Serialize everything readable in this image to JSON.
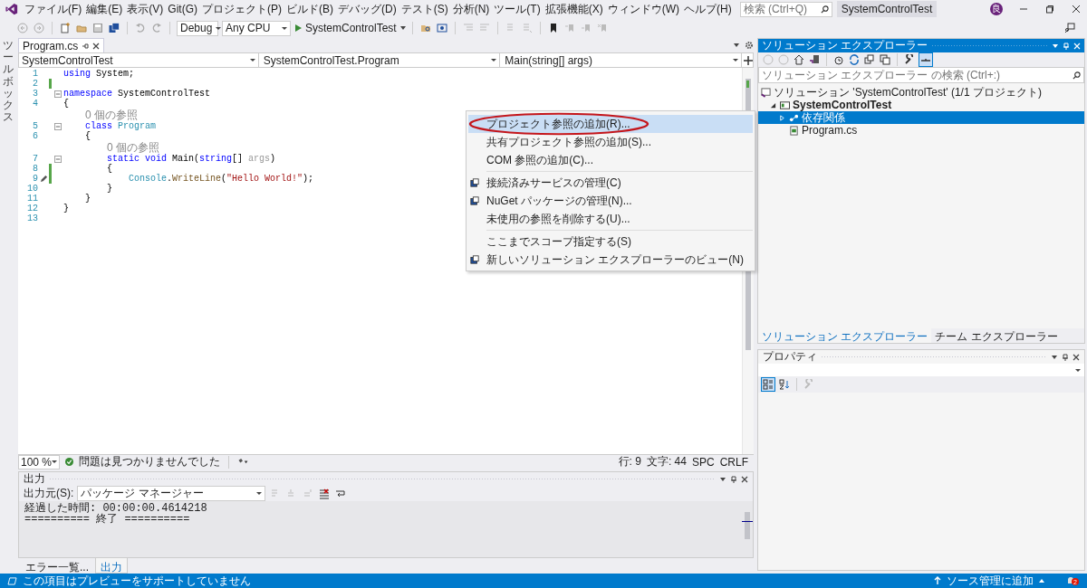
{
  "window": {
    "title": "SystemControlTest",
    "search": {
      "placeholder": "検索 (Ctrl+Q)"
    },
    "account_initial": "良"
  },
  "menu": [
    "ファイル(F)",
    "編集(E)",
    "表示(V)",
    "Git(G)",
    "プロジェクト(P)",
    "ビルド(B)",
    "デバッグ(D)",
    "テスト(S)",
    "分析(N)",
    "ツール(T)",
    "拡張機能(X)",
    "ウィンドウ(W)",
    "ヘルプ(H)"
  ],
  "toolbar": {
    "configuration": "Debug",
    "platform": "Any CPU",
    "start": "SystemControlTest"
  },
  "toolbox_label": "ツールボックス",
  "document_tabs": [
    {
      "label": "Program.cs",
      "selected": true
    }
  ],
  "nav_bar": [
    "SystemControlTest",
    "SystemControlTest.Program",
    "Main(string[] args)"
  ],
  "code_lines": [
    {
      "kind": "code",
      "number": "1",
      "changed": false,
      "fold": false,
      "quick_action": false,
      "segments": [
        {
          "kind": "kw",
          "text": "using"
        },
        {
          "kind": "plain",
          "text": " System;"
        }
      ]
    },
    {
      "kind": "code",
      "number": "2",
      "changed": true,
      "fold": false,
      "quick_action": false
    },
    {
      "kind": "code",
      "number": "3",
      "changed": false,
      "fold": true,
      "quick_action": false,
      "segments": [
        {
          "kind": "kw",
          "text": "namespace"
        },
        {
          "kind": "plain",
          "text": " SystemControlTest"
        }
      ]
    },
    {
      "kind": "code",
      "number": "4",
      "changed": false,
      "fold": false,
      "quick_action": false,
      "segments": [
        {
          "kind": "plain",
          "text": "{"
        }
      ]
    },
    {
      "kind": "codelens",
      "text": "0 個の参照"
    },
    {
      "kind": "code",
      "number": "5",
      "changed": false,
      "fold": true,
      "quick_action": false,
      "segments": [
        {
          "kind": "kw",
          "text": "class"
        },
        {
          "kind": "type",
          "text": " Program"
        }
      ]
    },
    {
      "kind": "code",
      "number": "6",
      "changed": false,
      "fold": false,
      "quick_action": false,
      "segments": [
        {
          "kind": "plain",
          "text": "{"
        }
      ]
    },
    {
      "kind": "codelens",
      "text": "0 個の参照"
    },
    {
      "kind": "code",
      "number": "7",
      "changed": false,
      "fold": true,
      "quick_action": false,
      "segments": [
        {
          "kind": "kw",
          "text": "static"
        },
        {
          "kind": "kw",
          "text": " void"
        },
        {
          "kind": "plain",
          "text": " Main("
        },
        {
          "kind": "kw",
          "text": "string"
        },
        {
          "kind": "plain",
          "text": "[] "
        },
        {
          "kind": "param",
          "text": "args"
        },
        {
          "kind": "plain",
          "text": ")"
        }
      ]
    },
    {
      "kind": "code",
      "number": "8",
      "changed": true,
      "fold": false,
      "quick_action": false,
      "segments": [
        {
          "kind": "plain",
          "text": "{"
        }
      ]
    },
    {
      "kind": "code",
      "number": "9",
      "changed": true,
      "fold": false,
      "quick_action": true,
      "segments": [
        {
          "kind": "type",
          "text": "Console"
        },
        {
          "kind": "plain",
          "text": "."
        },
        {
          "kind": "method",
          "text": "WriteLine"
        },
        {
          "kind": "plain",
          "text": "("
        },
        {
          "kind": "str",
          "text": "\"Hello World!\""
        },
        {
          "kind": "plain",
          "text": ");"
        }
      ]
    },
    {
      "kind": "code",
      "number": "10",
      "changed": false,
      "fold": false,
      "quick_action": false,
      "segments": [
        {
          "kind": "plain",
          "text": "}"
        }
      ]
    },
    {
      "kind": "code",
      "number": "11",
      "changed": false,
      "fold": false,
      "quick_action": false,
      "segments": [
        {
          "kind": "plain",
          "text": "}"
        }
      ]
    },
    {
      "kind": "code",
      "number": "12",
      "changed": false,
      "fold": false,
      "quick_action": false,
      "segments": [
        {
          "kind": "plain",
          "text": "}"
        }
      ]
    },
    {
      "kind": "code",
      "number": "13",
      "changed": false,
      "fold": false,
      "quick_action": false
    }
  ],
  "editor_status": {
    "zoom": "100 %",
    "issues": "問題は見つかりませんでした",
    "line": "行: 9",
    "column": "文字: 44",
    "spacing": "SPC",
    "line_ending": "CRLF"
  },
  "output": {
    "title": "出力",
    "source_label": "出力元(S):",
    "source": "パッケージ マネージャー",
    "lines": [
      "経過した時間: 00:00:00.4614218",
      "========== 終了 =========="
    ]
  },
  "bottom_tabs": [
    {
      "label": "エラー一覧...",
      "selected": false
    },
    {
      "label": "出力",
      "selected": true
    }
  ],
  "context_menu": {
    "groups": [
      [
        {
          "label": "プロジェクト参照の追加(R)...",
          "selected": true,
          "has_icon": false
        },
        {
          "label": "共有プロジェクト参照の追加(S)...",
          "selected": false,
          "has_icon": false
        },
        {
          "label": "COM 参照の追加(C)...",
          "selected": false,
          "has_icon": false
        }
      ],
      [
        {
          "label": "接続済みサービスの管理(C)",
          "selected": false,
          "has_icon": true
        },
        {
          "label": "NuGet パッケージの管理(N)...",
          "selected": false,
          "has_icon": true
        },
        {
          "label": "未使用の参照を削除する(U)...",
          "selected": false,
          "has_icon": false
        }
      ],
      [
        {
          "label": "ここまでスコープ指定する(S)",
          "selected": false,
          "has_icon": false
        },
        {
          "label": "新しいソリューション エクスプローラーのビュー(N)",
          "selected": false,
          "has_icon": true
        }
      ]
    ]
  },
  "solution_explorer": {
    "title": "ソリューション エクスプローラー",
    "search_placeholder": "ソリューション エクスプローラー の検索 (Ctrl+:)",
    "tree": [
      {
        "label": "ソリューション 'SystemControlTest' (1/1 プロジェクト)",
        "selected": false,
        "kind": "solution",
        "children": [
          {
            "label": "SystemControlTest",
            "selected": false,
            "kind": "project",
            "expanded": true,
            "children": [
              {
                "label": "依存関係",
                "selected": true,
                "kind": "dependencies",
                "expanded": false
              },
              {
                "label": "Program.cs",
                "selected": false,
                "kind": "file"
              }
            ]
          }
        ]
      }
    ]
  },
  "panel_tabs": [
    {
      "label": "ソリューション エクスプローラー",
      "selected": true
    },
    {
      "label": "チーム エクスプローラー",
      "selected": false
    }
  ],
  "properties": {
    "title": "プロパティ"
  },
  "status_bar": {
    "message": "この項目はプレビューをサポートしていません",
    "source_control": "ソース管理に追加",
    "notifications": "2"
  }
}
